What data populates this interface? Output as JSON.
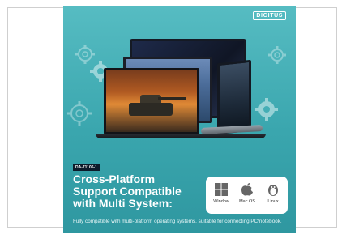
{
  "brand": {
    "logo_text": "DIGITUS"
  },
  "product": {
    "model": "DA-71106-1"
  },
  "headline": "Cross-Platform Support Compatible with Multi System:",
  "os_support": [
    {
      "label": "Window",
      "icon": "windows-icon"
    },
    {
      "label": "Mac OS",
      "icon": "apple-icon"
    },
    {
      "label": "Linux",
      "icon": "linux-tux-icon"
    }
  ],
  "description": "Fully compatible with multi-platform operating systems, suitable for connecting PC/notebook.",
  "colors": {
    "background": "#49b3ba",
    "text": "#ffffff",
    "panel": "#ffffff"
  }
}
